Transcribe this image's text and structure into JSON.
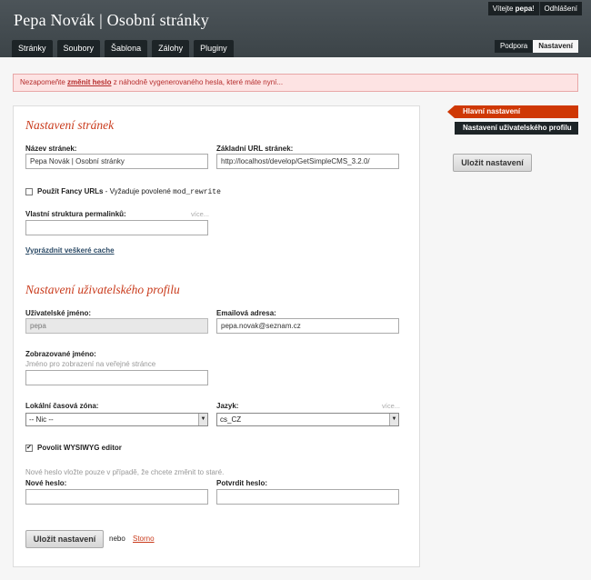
{
  "header": {
    "site_title": "Pepa Novák | Osobní stránky",
    "welcome_prefix": "Vítejte ",
    "welcome_user": "pepa",
    "welcome_suffix": "!",
    "logout": "Odhlášení",
    "tabs": [
      "Stránky",
      "Soubory",
      "Šablona",
      "Zálohy",
      "Pluginy"
    ],
    "right_tabs": [
      {
        "label": "Podpora",
        "active": false
      },
      {
        "label": "Nastavení",
        "active": true
      }
    ]
  },
  "notice": {
    "prefix": "Nezapomeňte ",
    "link": "změnit heslo",
    "suffix": " z náhodně vygenerovaného hesla, které máte nyní..."
  },
  "site_settings": {
    "title": "Nastavení stránek",
    "site_name_label": "Název stránek:",
    "site_name_value": "Pepa Novák | Osobní stránky",
    "base_url_label": "Základní URL stránek:",
    "base_url_value": "http://localhost/develop/GetSimpleCMS_3.2.0/",
    "fancy_urls_label": "Použít Fancy URLs",
    "fancy_urls_note": " - Vyžaduje povolené ",
    "fancy_urls_code": "mod_rewrite",
    "fancy_urls_checked": false,
    "permalink_label": "Vlastní struktura permalinků:",
    "permalink_more": "více...",
    "permalink_value": "",
    "clear_cache": "Vyprázdnit veškeré cache"
  },
  "profile_settings": {
    "title": "Nastavení uživatelského profilu",
    "username_label": "Uživatelské jméno:",
    "username_value": "pepa",
    "email_label": "Emailová adresa:",
    "email_value": "pepa.novak@seznam.cz",
    "display_name_label": "Zobrazované jméno:",
    "display_name_hint": "Jméno pro zobrazení na veřejné stránce",
    "display_name_value": "",
    "timezone_label": "Lokální časová zóna:",
    "timezone_value": "-- Nic --",
    "language_label": "Jazyk:",
    "language_more": "více...",
    "language_value": "cs_CZ",
    "wysiwyg_label": "Povolit WYSIWYG editor",
    "wysiwyg_checked": true,
    "password_hint": "Nové heslo vložte pouze v případě, že chcete změnit to staré.",
    "new_password_label": "Nové heslo:",
    "confirm_password_label": "Potvrdit heslo:"
  },
  "actions": {
    "save": "Uložit nastavení",
    "or": "nebo",
    "cancel": "Storno"
  },
  "sidebar": {
    "items": [
      {
        "label": "Hlavní nastavení",
        "active": true
      },
      {
        "label": "Nastavení uživatelského profilu",
        "active": false
      }
    ],
    "save": "Uložit nastavení"
  },
  "icons": {
    "select_arrow": "chevron-down-icon",
    "checkbox": "checkbox-icon"
  },
  "colors": {
    "accent": "#cf3805",
    "header_bg": "#444c50",
    "tab_bg": "#1d2427",
    "notice_bg": "#fde3e3",
    "notice_text": "#b52d2d",
    "section_title": "#c93a1b"
  }
}
